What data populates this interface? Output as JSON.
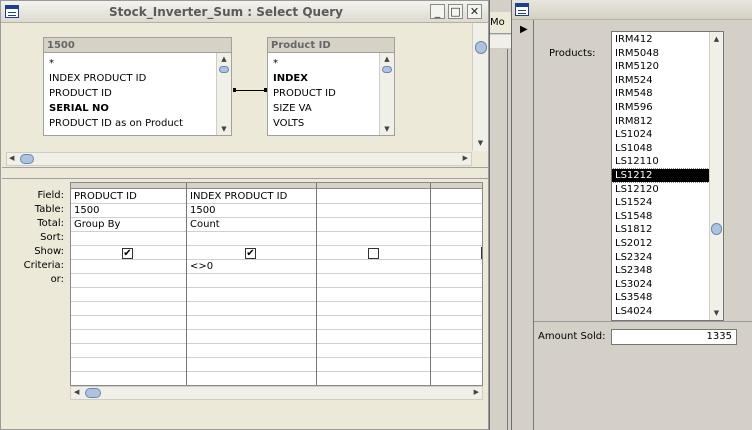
{
  "query_window": {
    "title": "Stock_Inverter_Sum : Select Query",
    "controls": [
      "_",
      "□",
      "✕"
    ]
  },
  "tables": [
    {
      "name": "1500",
      "fields": [
        {
          "label": "*",
          "bold": false
        },
        {
          "label": "INDEX PRODUCT ID",
          "bold": false
        },
        {
          "label": "PRODUCT ID",
          "bold": false
        },
        {
          "label": "SERIAL NO",
          "bold": true
        },
        {
          "label": "PRODUCT ID as on Product",
          "bold": false
        }
      ]
    },
    {
      "name": "Product ID",
      "fields": [
        {
          "label": "*",
          "bold": false
        },
        {
          "label": "INDEX",
          "bold": true
        },
        {
          "label": "PRODUCT ID",
          "bold": false
        },
        {
          "label": "SIZE VA",
          "bold": false
        },
        {
          "label": "VOLTS",
          "bold": false
        }
      ]
    }
  ],
  "grid": {
    "row_labels": [
      "Field:",
      "Table:",
      "Total:",
      "Sort:",
      "Show:",
      "Criteria:",
      "or:"
    ],
    "columns": [
      {
        "field": "PRODUCT ID",
        "table": "1500",
        "total": "Group By",
        "sort": "",
        "show": true,
        "criteria": "",
        "or": ""
      },
      {
        "field": "INDEX PRODUCT ID",
        "table": "1500",
        "total": "Count",
        "sort": "",
        "show": true,
        "criteria": "<>0",
        "or": ""
      },
      {
        "field": "",
        "table": "",
        "total": "",
        "sort": "",
        "show": false,
        "criteria": "",
        "or": ""
      },
      {
        "field": "",
        "table": "",
        "total": "",
        "sort": "",
        "show": null,
        "criteria": "",
        "or": ""
      }
    ]
  },
  "middle_window": {
    "title_fragment": "Mo"
  },
  "form_window": {
    "products_label": "Products:",
    "products": [
      "IRM412",
      "IRM5048",
      "IRM5120",
      "IRM524",
      "IRM548",
      "IRM596",
      "IRM812",
      "LS1024",
      "LS1048",
      "LS12110",
      "LS1212",
      "LS12120",
      "LS1524",
      "LS1548",
      "LS1812",
      "LS2012",
      "LS2324",
      "LS2348",
      "LS3024",
      "LS3548",
      "LS4024"
    ],
    "selected_product": "LS1212",
    "amount_label": "Amount Sold:",
    "amount_value": "1335"
  },
  "icons": {
    "window_icon": "form-window-icon",
    "record_selector": "record-pointer-icon",
    "check": "✔"
  },
  "colors": {
    "scroll_thumb": "#aec3de",
    "selection_bg": "#000000",
    "window_bg": "#ece9d8"
  }
}
